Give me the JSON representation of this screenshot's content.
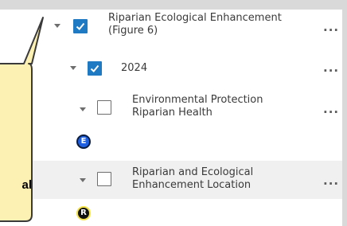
{
  "layers": [
    {
      "label": "Riparian Ecological Enhancement (Figure 6)",
      "checked": true,
      "options_icon": "more-options-icon"
    },
    {
      "label": "2024",
      "checked": true,
      "options_icon": "more-options-icon"
    },
    {
      "label": "Environmental Protection Riparian Health",
      "checked": false,
      "options_icon": "more-options-icon",
      "legend_symbol": "E"
    },
    {
      "label": "Riparian and Ecological Enhancement Location",
      "checked": false,
      "options_icon": "more-options-icon",
      "legend_symbol": "R"
    }
  ],
  "menu_glyph": "...",
  "callout": {
    "text_fragment": "al"
  },
  "colors": {
    "check_blue": "#1f7ac3",
    "callout_fill": "#fdf0b3",
    "callout_border": "#3a3a3a",
    "hover_row": "#f0f0f0",
    "legend_e_fill": "#1d5fe0",
    "legend_r_ring": "#f4e24a"
  }
}
